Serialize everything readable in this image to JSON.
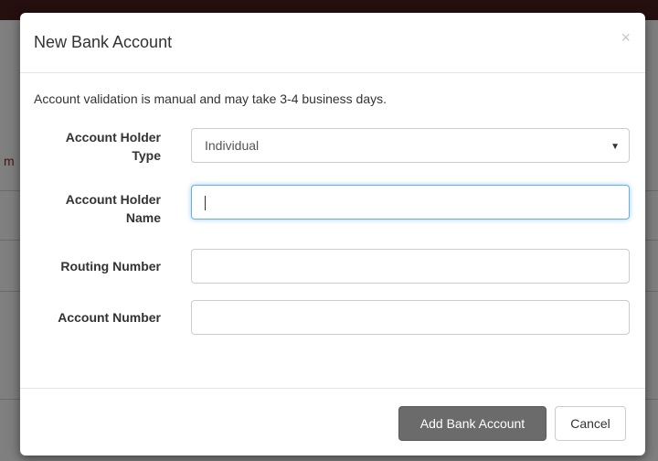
{
  "modal": {
    "title": "New Bank Account",
    "close_glyph": "×",
    "notice": "Account validation is manual and may take 3-4 business days."
  },
  "form": {
    "account_holder_type": {
      "label_line1": "Account Holder",
      "label_line2": "Type",
      "selected": "Individual"
    },
    "account_holder_name": {
      "label_line1": "Account Holder",
      "label_line2": "Name",
      "value": ""
    },
    "routing_number": {
      "label": "Routing Number",
      "value": ""
    },
    "account_number": {
      "label": "Account Number",
      "value": ""
    }
  },
  "footer": {
    "add_button": "Add Bank Account",
    "cancel_button": "Cancel"
  },
  "colors": {
    "primary_button": "#6b6b6b",
    "focus_border": "#66afe9",
    "topbar": "#4a1f1f"
  },
  "icons": {
    "close": "close-icon",
    "select_caret": "caret-down-icon"
  }
}
